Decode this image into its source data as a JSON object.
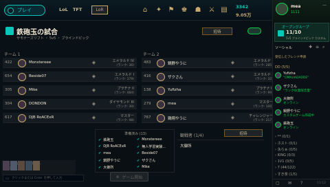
{
  "topbar": {
    "play_label": "プレイ",
    "tabs": [
      "LoL",
      "TFT"
    ],
    "active_tab": "LoR",
    "blue_essence": "3342",
    "orange_essence": "9.05万"
  },
  "lobby": {
    "title": "鉄砲玉の試合",
    "subtitle": "サモナーズリフト ・ 5v5 ・ ブラインドピック",
    "invite_label": "招待",
    "team1_label": "チーム 1",
    "team2_label": "チーム 2",
    "team1": [
      {
        "level": "422",
        "name": "Monstereee",
        "rank": "エメラルド IV",
        "lp": "(ランク: 36)"
      },
      {
        "level": "654",
        "name": "Beside07",
        "rank": "エメラルド I",
        "lp": "(ランク: 179)"
      },
      {
        "level": "305",
        "name": "Mike",
        "rank": "プラチナ II",
        "lp": "(ランク: 484)"
      },
      {
        "level": "304",
        "name": "DONDON",
        "rank": "ダイヤモンド III",
        "lp": "(ランク: 30)"
      },
      {
        "level": "617",
        "name": "DJB RoACExR",
        "rank": "マスター",
        "lp": "(ランク: 98)"
      }
    ],
    "team2": [
      {
        "level": "483",
        "name": "鍋野やうに",
        "rank": "エメラルド I",
        "lp": "(ランク: 285)"
      },
      {
        "level": "416",
        "name": "ザクさん",
        "rank": "エメラルド I",
        "lp": "(ランク: 32)"
      },
      {
        "level": "138",
        "name": "Yufizha",
        "rank": "プラチナ II",
        "lp": "(ランク: 99)"
      },
      {
        "level": "279",
        "name": "mea",
        "rank": "マスター",
        "lp": "(ランク: 100)"
      },
      {
        "level": "767",
        "name": "鶏翔やうに",
        "rank": "チャレンジャー",
        "lp": "(ランク: 217)"
      }
    ],
    "ready_header": "準備済み (13)",
    "ready_col1": [
      "鉄砲玉",
      "DJB RoACExR",
      "mea",
      "鍋野やうに",
      "大御所"
    ],
    "ready_col2": [
      "Monstereee",
      "無人学習実験...",
      "Beside07",
      "ザクさん",
      "Mike"
    ],
    "spectators_label": "観戦者 (1/4)",
    "spectator_invite": "招待",
    "spectators": [
      "大御所"
    ],
    "chat_preview": "いらっしゃいませ ロビー...",
    "chat_preview2": "から退出しました。",
    "chat_placeholder": "クリックまたは Enter を押して入力",
    "start_label": "ゲーム開始"
  },
  "social": {
    "username": "mea",
    "status": "1111",
    "lobby_title": "オープングループ",
    "lobby_count": "11/10",
    "lobby_mode": "5v5 ブラインドピック カスタム",
    "social_label": "ソーシャル",
    "request_label": "受信したフレンド申請",
    "dd_group": "DD (5/5)",
    "friends": [
      {
        "name": "Yufizha",
        "status": "\"OMAUADADDE\""
      },
      {
        "name": "ザクさん",
        "status": "\"ランクQ(無限音量\""
      },
      {
        "name": "大御所",
        "status": "オンライン"
      },
      {
        "name": "鍋野やうに",
        "status": "カスタムゲーム作成中"
      },
      {
        "name": "鉄砲玉",
        "status": "オンライン"
      }
    ],
    "groups": [
      "** (0/1)",
      "ホスト (0/1)",
      "永らぁ (0/5)",
      "KING (0/3)",
      "1V1 (0/5)",
      "7 (44/122)",
      "すき茶 (1/5)"
    ],
    "footer_version": "11:12"
  },
  "colors": {
    "accent": "#0ac8b9",
    "gold": "#c8aa6e",
    "online": "#0acd49"
  }
}
